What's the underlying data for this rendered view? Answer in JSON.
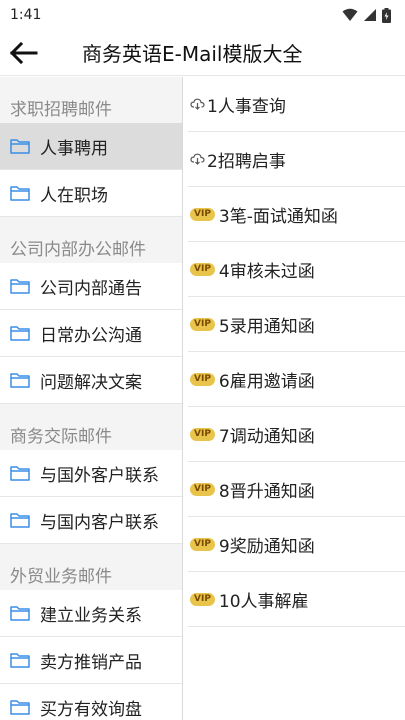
{
  "status": {
    "time": "1:41"
  },
  "header": {
    "title": "商务英语E-Mail模版大全"
  },
  "sidebar": {
    "groups": [
      {
        "title": "求职招聘邮件",
        "items": [
          {
            "label": "人事聘用",
            "selected": true
          },
          {
            "label": "人在职场"
          }
        ]
      },
      {
        "title": "公司内部办公邮件",
        "items": [
          {
            "label": "公司内部通告"
          },
          {
            "label": "日常办公沟通"
          },
          {
            "label": "问题解决文案"
          }
        ]
      },
      {
        "title": "商务交际邮件",
        "items": [
          {
            "label": "与国外客户联系"
          },
          {
            "label": "与国内客户联系"
          }
        ]
      },
      {
        "title": "外贸业务邮件",
        "items": [
          {
            "label": "建立业务关系"
          },
          {
            "label": "卖方推销产品"
          },
          {
            "label": "买方有效询盘"
          }
        ]
      }
    ]
  },
  "main": {
    "vip_badge": "VIP",
    "items": [
      {
        "label": "1人事查询",
        "type": "cloud"
      },
      {
        "label": "2招聘启事",
        "type": "cloud"
      },
      {
        "label": "3笔-面试通知函",
        "type": "vip"
      },
      {
        "label": "4审核未过函",
        "type": "vip"
      },
      {
        "label": "5录用通知函",
        "type": "vip"
      },
      {
        "label": "6雇用邀请函",
        "type": "vip"
      },
      {
        "label": "7调动通知函",
        "type": "vip"
      },
      {
        "label": "8晋升通知函",
        "type": "vip"
      },
      {
        "label": "9奖励通知函",
        "type": "vip"
      },
      {
        "label": "10人事解雇",
        "type": "vip"
      }
    ]
  },
  "colors": {
    "folder": "#3a8ee6",
    "vip_bg": "#e8c44a",
    "selected_bg": "#dcdcdc",
    "sidebar_bg": "#f4f4f4"
  },
  "icons": {
    "back": "arrow-left-icon",
    "folder": "folder-icon",
    "cloud": "cloud-download-icon",
    "wifi": "wifi-icon",
    "signal": "signal-icon",
    "battery": "battery-icon"
  }
}
